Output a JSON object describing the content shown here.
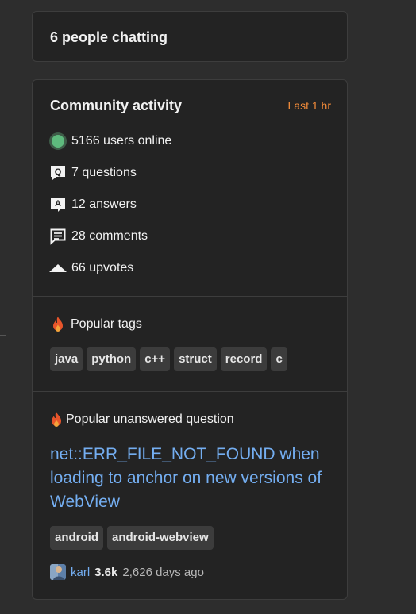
{
  "chat": {
    "title": "6 people chatting"
  },
  "activity": {
    "title": "Community activity",
    "range": "Last 1 hr",
    "stats": [
      {
        "icon": "online-dot-icon",
        "label": "5166 users online"
      },
      {
        "icon": "question-icon",
        "label": "7 questions"
      },
      {
        "icon": "answer-icon",
        "label": "12 answers"
      },
      {
        "icon": "comment-icon",
        "label": "28 comments"
      },
      {
        "icon": "upvote-icon",
        "label": "66 upvotes"
      }
    ],
    "popular_tags": {
      "label": "Popular tags",
      "tags": [
        "java",
        "python",
        "c++",
        "struct",
        "record",
        "c"
      ]
    },
    "unanswered": {
      "label": "Popular unanswered question",
      "title": "net::ERR_FILE_NOT_FOUND when loading to anchor on new versions of WebView",
      "tags": [
        "android",
        "android-webview"
      ],
      "user": "karl",
      "reputation": "3.6k",
      "time": "2,626 days ago"
    }
  },
  "colors": {
    "accent_orange": "#f48c3a",
    "link_blue": "#74aef1",
    "online_green": "#5eba7d"
  }
}
